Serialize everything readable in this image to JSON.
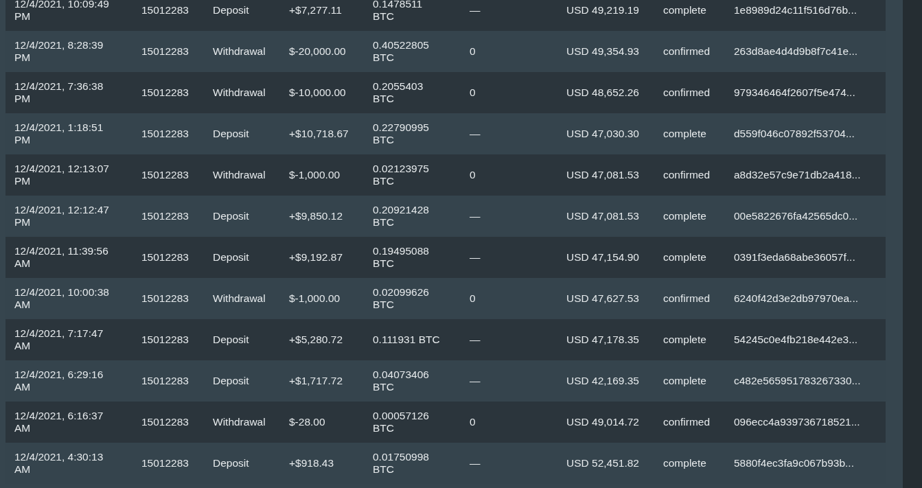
{
  "table": {
    "rows": [
      {
        "date": "12/4/2021, 10:09:49 PM",
        "account": "15012283",
        "type": "Deposit",
        "amount": "+$7,277.11",
        "btc": "0.1478511 BTC",
        "fee": "—",
        "usd": "USD 49,219.19",
        "status": "complete",
        "hash": "1e8989d24c11f516d76b..."
      },
      {
        "date": "12/4/2021, 8:28:39 PM",
        "account": "15012283",
        "type": "Withdrawal",
        "amount": "$-20,000.00",
        "btc": "0.40522805 BTC",
        "fee": "0",
        "usd": "USD 49,354.93",
        "status": "confirmed",
        "hash": "263d8ae4d4d9b8f7c41e..."
      },
      {
        "date": "12/4/2021, 7:36:38 PM",
        "account": "15012283",
        "type": "Withdrawal",
        "amount": "$-10,000.00",
        "btc": "0.2055403 BTC",
        "fee": "0",
        "usd": "USD 48,652.26",
        "status": "confirmed",
        "hash": "979346464f2607f5e474..."
      },
      {
        "date": "12/4/2021, 1:18:51 PM",
        "account": "15012283",
        "type": "Deposit",
        "amount": "+$10,718.67",
        "btc": "0.22790995 BTC",
        "fee": "—",
        "usd": "USD 47,030.30",
        "status": "complete",
        "hash": "d559f046c07892f53704..."
      },
      {
        "date": "12/4/2021, 12:13:07 PM",
        "account": "15012283",
        "type": "Withdrawal",
        "amount": "$-1,000.00",
        "btc": "0.02123975 BTC",
        "fee": "0",
        "usd": "USD 47,081.53",
        "status": "confirmed",
        "hash": "a8d32e57c9e71db2a418..."
      },
      {
        "date": "12/4/2021, 12:12:47 PM",
        "account": "15012283",
        "type": "Deposit",
        "amount": "+$9,850.12",
        "btc": "0.20921428 BTC",
        "fee": "—",
        "usd": "USD 47,081.53",
        "status": "complete",
        "hash": "00e5822676fa42565dc0..."
      },
      {
        "date": "12/4/2021, 11:39:56 AM",
        "account": "15012283",
        "type": "Deposit",
        "amount": "+$9,192.87",
        "btc": "0.19495088 BTC",
        "fee": "—",
        "usd": "USD 47,154.90",
        "status": "complete",
        "hash": "0391f3eda68abe36057f..."
      },
      {
        "date": "12/4/2021, 10:00:38 AM",
        "account": "15012283",
        "type": "Withdrawal",
        "amount": "$-1,000.00",
        "btc": "0.02099626 BTC",
        "fee": "0",
        "usd": "USD 47,627.53",
        "status": "confirmed",
        "hash": "6240f42d3e2db97970ea..."
      },
      {
        "date": "12/4/2021, 7:17:47 AM",
        "account": "15012283",
        "type": "Deposit",
        "amount": "+$5,280.72",
        "btc": "0.111931 BTC",
        "fee": "—",
        "usd": "USD 47,178.35",
        "status": "complete",
        "hash": "54245c0e4fb218e442e3..."
      },
      {
        "date": "12/4/2021, 6:29:16 AM",
        "account": "15012283",
        "type": "Deposit",
        "amount": "+$1,717.72",
        "btc": "0.04073406 BTC",
        "fee": "—",
        "usd": "USD 42,169.35",
        "status": "complete",
        "hash": "c482e565951783267330..."
      },
      {
        "date": "12/4/2021, 6:16:37 AM",
        "account": "15012283",
        "type": "Withdrawal",
        "amount": "$-28.00",
        "btc": "0.00057126 BTC",
        "fee": "0",
        "usd": "USD 49,014.72",
        "status": "confirmed",
        "hash": "096ecc4a939736718521..."
      },
      {
        "date": "12/4/2021, 4:30:13 AM",
        "account": "15012283",
        "type": "Deposit",
        "amount": "+$918.43",
        "btc": "0.01750998 BTC",
        "fee": "—",
        "usd": "USD 52,451.82",
        "status": "complete",
        "hash": "5880f4ec3fa9c067b93b..."
      }
    ]
  }
}
